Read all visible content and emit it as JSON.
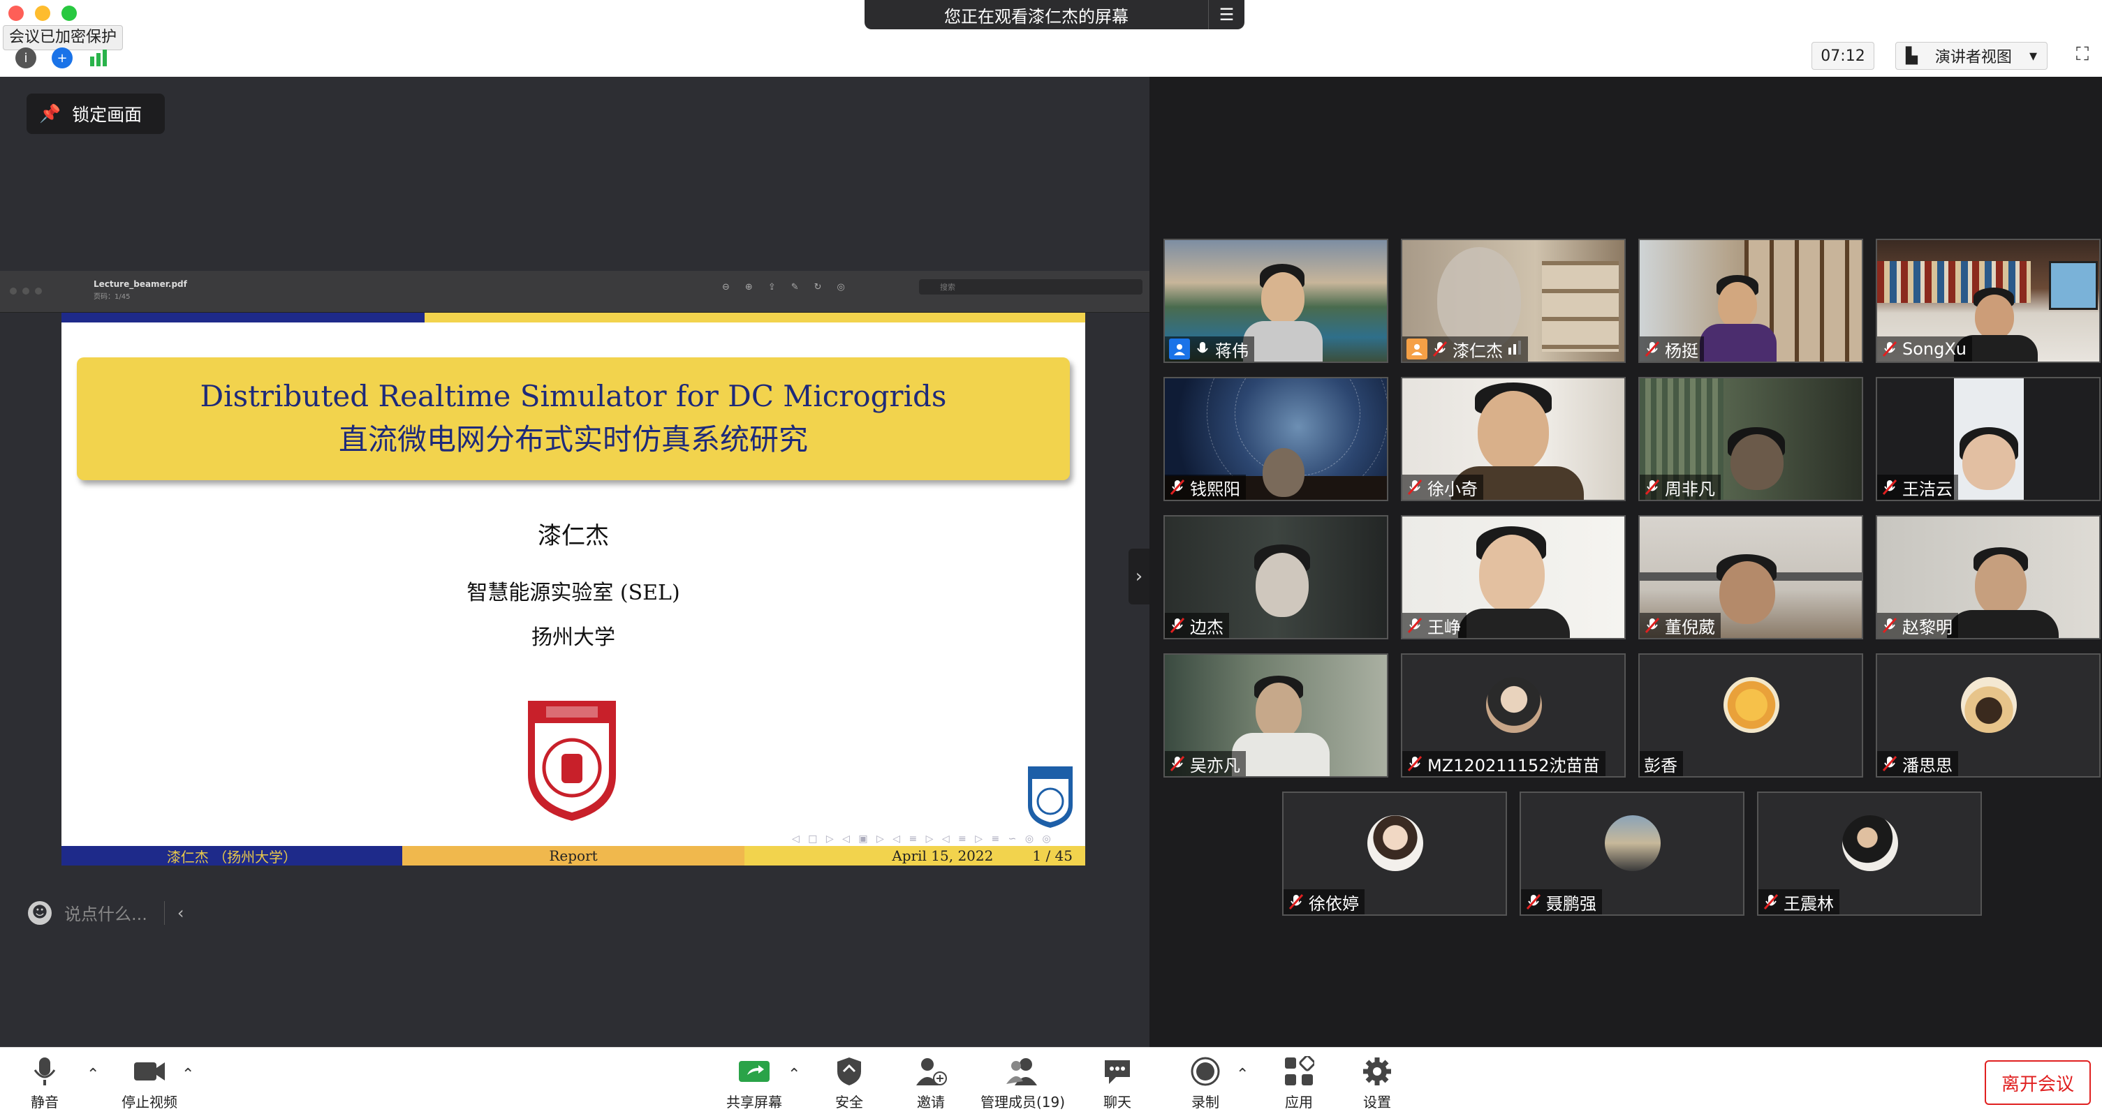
{
  "window": {
    "encryption_badge": "会议已加密保护",
    "viewing_banner": "您正在观看漆仁杰的屏幕",
    "timer": "07:12",
    "view_mode": "演讲者视图"
  },
  "share": {
    "lock_button": "锁定画面",
    "pdf": {
      "filename": "Lecture_beamer.pdf",
      "page_info": "页码：1/45",
      "search_placeholder": "搜索"
    },
    "slide": {
      "title_en": "Distributed Realtime Simulator for DC Microgrids",
      "title_cn": "直流微电网分布式实时仿真系统研究",
      "author": "漆仁杰",
      "lab": "智慧能源实验室 (SEL)",
      "university": "扬州大学",
      "footer_author": "漆仁杰 （扬州大学）",
      "footer_title": "Report",
      "footer_date": "April 15, 2022",
      "footer_page": "1 / 45"
    },
    "chat_placeholder": "说点什么..."
  },
  "participants": [
    {
      "name": "蒋伟"
    },
    {
      "name": "漆仁杰"
    },
    {
      "name": "杨挺"
    },
    {
      "name": "SongXu"
    },
    {
      "name": "钱熙阳"
    },
    {
      "name": "徐小奇"
    },
    {
      "name": "周非凡"
    },
    {
      "name": "王洁云"
    },
    {
      "name": "边杰"
    },
    {
      "name": "王峥"
    },
    {
      "name": "董倪葳"
    },
    {
      "name": "赵黎明"
    },
    {
      "name": "吴亦凡"
    },
    {
      "name": "MZ120211152沈苗苗"
    },
    {
      "name": "彭香"
    },
    {
      "name": "潘思思"
    },
    {
      "name": "徐依婷"
    },
    {
      "name": "聂鹏强"
    },
    {
      "name": "王震林"
    }
  ],
  "toolbar": {
    "mute": "静音",
    "stop_video": "停止视频",
    "share_screen": "共享屏幕",
    "security": "安全",
    "invite": "邀请",
    "participants": "管理成员(19)",
    "chat": "聊天",
    "record": "录制",
    "apps": "应用",
    "settings": "设置",
    "leave": "离开会议"
  },
  "colors": {
    "accent_red": "#e02020",
    "beamer_blue": "#1e2a8a",
    "beamer_yellow": "#f2d34d",
    "gallery_bg": "#1c1c1e",
    "share_bg": "#2d2e33"
  }
}
